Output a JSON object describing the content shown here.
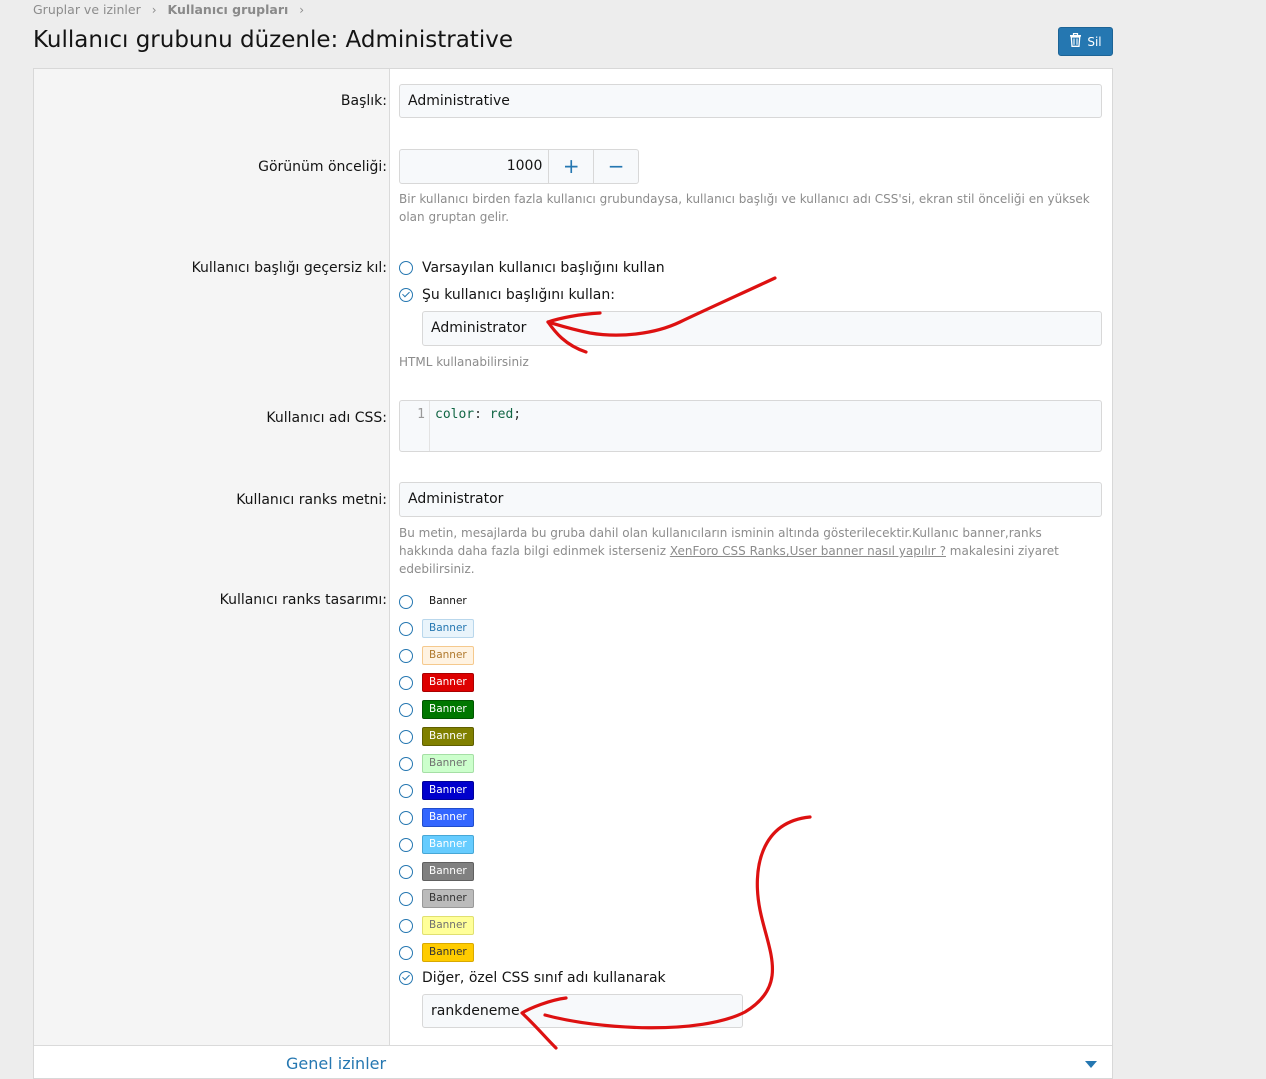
{
  "breadcrumb": {
    "item1": "Gruplar ve izinler",
    "item2": "Kullanıcı grupları"
  },
  "page_title": "Kullanıcı grubunu düzenle: Administrative",
  "delete_button": "Sil",
  "fields": {
    "title": {
      "label": "Başlık:",
      "value": "Administrative"
    },
    "display_priority": {
      "label": "Görünüm önceliği:",
      "value": "1000",
      "plus": "+",
      "minus": "−",
      "hint": "Bir kullanıcı birden fazla kullanıcı grubundaysa, kullanıcı başlığı ve kullanıcı adı CSS'si, ekran stil önceliği en yüksek olan gruptan gelir."
    },
    "user_title_override": {
      "label": "Kullanıcı başlığı geçersiz kıl:",
      "option_default": "Varsayılan kullanıcı başlığını kullan",
      "option_custom": "Şu kullanıcı başlığını kullan:",
      "custom_value": "Administrator",
      "hint": "HTML kullanabilirsiniz"
    },
    "username_css": {
      "label": "Kullanıcı adı CSS:",
      "line_number": "1",
      "code_property": "color",
      "code_colon": ":",
      "code_value": "red",
      "code_semicolon": ";"
    },
    "rank_text": {
      "label": "Kullanıcı ranks metni:",
      "value": "Administrator",
      "hint_before": "Bu metin, mesajlarda bu gruba dahil olan kullanıcıların isminin altında gösterilecektir.Kullanıc banner,ranks hakkında daha fazla bilgi edinmek isterseniz ",
      "hint_link": "XenForo CSS Ranks,User banner nasıl yapılır ?",
      "hint_after": " makalesini ziyaret edebilirsiniz."
    },
    "rank_style": {
      "label": "Kullanıcı ranks tasarımı:",
      "banners": [
        {
          "text": "Banner",
          "bg": "#ffffff",
          "fg": "#141414",
          "border": "#ffffff"
        },
        {
          "text": "Banner",
          "bg": "#e9f4fb",
          "fg": "#2577b1",
          "border": "#b9d7ec"
        },
        {
          "text": "Banner",
          "bg": "#fff3e2",
          "fg": "#b07a2e",
          "border": "#f5c98d"
        },
        {
          "text": "Banner",
          "bg": "#dd0000",
          "fg": "#ffffff",
          "border": "#aa0000"
        },
        {
          "text": "Banner",
          "bg": "#007700",
          "fg": "#ffffff",
          "border": "#005500"
        },
        {
          "text": "Banner",
          "bg": "#808000",
          "fg": "#ffffff",
          "border": "#5f5f00"
        },
        {
          "text": "Banner",
          "bg": "#ccffcc",
          "fg": "#707070",
          "border": "#a5dfa5"
        },
        {
          "text": "Banner",
          "bg": "#0000cc",
          "fg": "#ffffff",
          "border": "#00009a"
        },
        {
          "text": "Banner",
          "bg": "#3366ff",
          "fg": "#ffffff",
          "border": "#204dcc"
        },
        {
          "text": "Banner",
          "bg": "#66ccff",
          "fg": "#ffffff",
          "border": "#47a7d6"
        },
        {
          "text": "Banner",
          "bg": "#808080",
          "fg": "#ffffff",
          "border": "#606060"
        },
        {
          "text": "Banner",
          "bg": "#bbbbbb",
          "fg": "#333333",
          "border": "#999999"
        },
        {
          "text": "Banner",
          "bg": "#ffff99",
          "fg": "#707070",
          "border": "#e0e070"
        },
        {
          "text": "Banner",
          "bg": "#ffcc00",
          "fg": "#333333",
          "border": "#d9a900"
        }
      ],
      "other_option": "Diğer, özel CSS sınıf adı kullanarak",
      "other_value": "rankdeneme"
    }
  },
  "sections": {
    "general_permissions": "Genel izinler"
  },
  "colors": {
    "accent": "#2577b1",
    "annotation": "#dd1111"
  },
  "icons": {
    "delete": "trash-icon",
    "expand": "chevron-down-icon"
  }
}
